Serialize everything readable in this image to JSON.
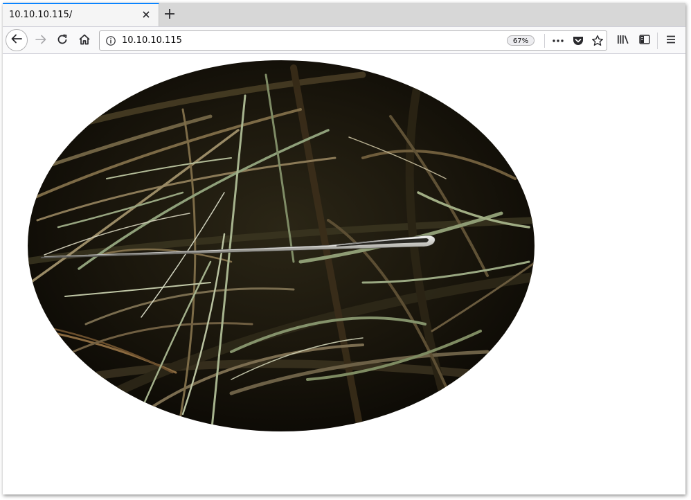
{
  "tab": {
    "title": "10.10.10.115/"
  },
  "url_bar": {
    "url": "10.10.10.115",
    "zoom": "67%"
  },
  "icons": {
    "back": "back-arrow-icon",
    "forward": "forward-arrow-icon",
    "reload": "reload-icon",
    "home": "home-icon",
    "info": "info-icon",
    "more": "more-dots-icon",
    "pocket": "pocket-icon",
    "bookmark": "bookmark-star-icon",
    "library": "library-icon",
    "sidebar": "sidebar-icon",
    "menu": "hamburger-menu-icon",
    "close_tab": "close-icon",
    "new_tab": "plus-icon"
  },
  "colors": {
    "active_tab_accent": "#0a84ff",
    "toolbar": "#f9f9fa",
    "tabstrip": "#d7d7d7"
  },
  "content": {
    "image": "needle-in-haystack"
  }
}
